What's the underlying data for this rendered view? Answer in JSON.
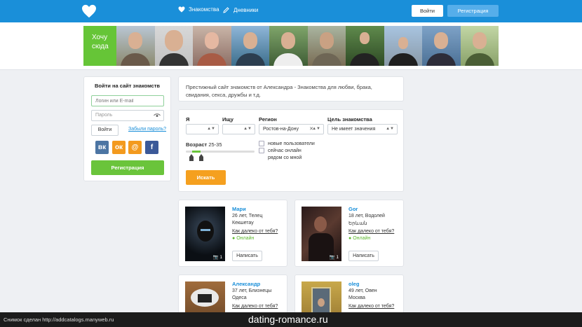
{
  "header": {
    "nav": [
      {
        "label": "Знакомства",
        "icon": "heart-icon"
      },
      {
        "label": "Дневники",
        "icon": "pencil-icon"
      }
    ],
    "login_label": "Войти",
    "register_label": "Регистрация",
    "colors": {
      "bar": "#1a8fd9",
      "register": "#56aeea"
    }
  },
  "strip": {
    "want_label_1": "Хочу",
    "want_label_2": "сюда",
    "accent": "#66c537"
  },
  "login": {
    "title": "Войти на сайт знакомств",
    "login_placeholder": "Логин или E-mail",
    "password_placeholder": "Пароль",
    "submit_label": "Войти",
    "forgot_label": "Забыли пароль?",
    "socials": [
      {
        "icon": "vk-icon",
        "glyph": "вк",
        "color": "#4c75a3"
      },
      {
        "icon": "odnoklassniki-icon",
        "glyph": "ок",
        "color": "#f39a1e"
      },
      {
        "icon": "mailru-icon",
        "glyph": "@",
        "color": "#f39a1e"
      },
      {
        "icon": "facebook-icon",
        "glyph": "f",
        "color": "#3b5998"
      }
    ],
    "register_label": "Регистрация"
  },
  "intro": {
    "text": "Престижный сайт знакомств от Александра - Знакомства для любви, брака, свидания, секса, дружбы и т.д."
  },
  "filter": {
    "i_label": "Я",
    "seek_label": "Ищу",
    "region_label": "Регион",
    "region_value": "Ростов-на-Дону",
    "goal_label": "Цель знакомства",
    "goal_value": "Не имеет значения",
    "age_label": "Возраст",
    "age_value": "25-35",
    "age_range": [
      25,
      35
    ],
    "checkboxes": [
      "новые пользователи",
      "сейчас онлайн",
      "рядом со мной"
    ],
    "search_label": "Искать",
    "search_color": "#f5a01f"
  },
  "users": [
    {
      "name": "Мари",
      "info": "26 лет, Телец",
      "city": "Кекшетау",
      "distance": "Как далеко от тебя?",
      "status": "Онлайн",
      "photos": "1",
      "write": "Написать"
    },
    {
      "name": "Gor",
      "info": "18 лет, Водолей",
      "city": "Երևան",
      "distance": "Как далеко от тебя?",
      "status": "Онлайн",
      "photos": "1",
      "write": "Написать"
    },
    {
      "name": "Александр",
      "info": "37 лет, Близнецы",
      "city": "Одеса",
      "distance": "Как далеко от тебя?",
      "status": "",
      "photos": "",
      "write": ""
    },
    {
      "name": "oleg",
      "info": "49 лет, Овен",
      "city": "Москва",
      "distance": "Как далеко от тебя?",
      "status": "",
      "photos": "",
      "write": ""
    }
  ],
  "footer": {
    "credit": "Снимок сделан http://addcatalogs.manyweb.ru",
    "domain": "dating-romance.ru"
  }
}
